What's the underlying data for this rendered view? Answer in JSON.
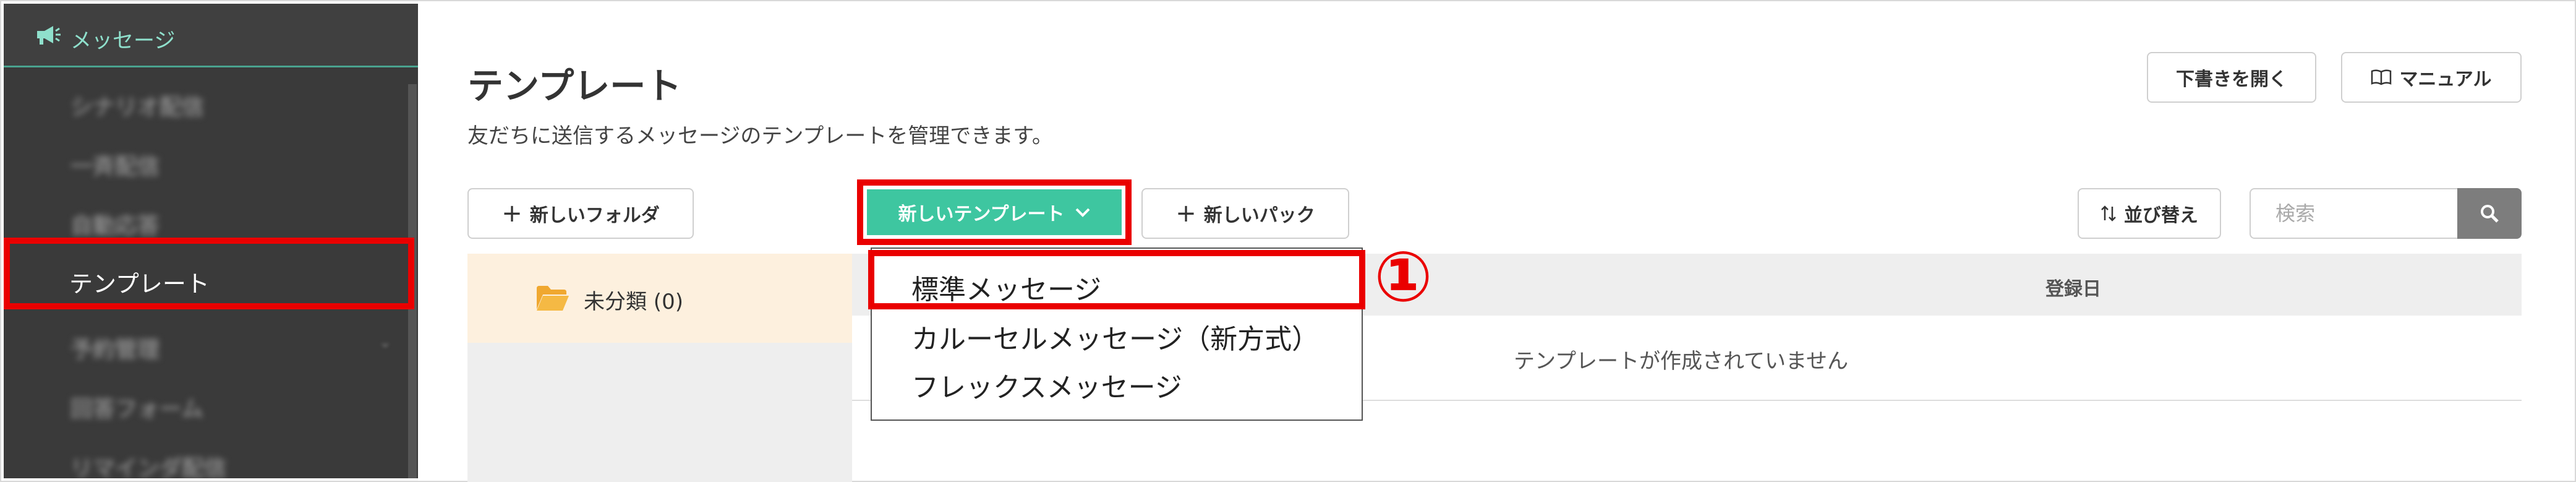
{
  "sidebar": {
    "section_label": "メッセージ",
    "blurred_items": [
      "シナリオ配信",
      "一斉配信",
      "自動応答",
      "予約管理",
      "回答フォーム",
      "リマインダ配信"
    ],
    "active_item": "テンプレート"
  },
  "page": {
    "title": "テンプレート",
    "subtitle": "友だちに送信するメッセージのテンプレートを管理できます。"
  },
  "header_buttons": {
    "open_draft": "下書きを開く",
    "manual": "マニュアル"
  },
  "toolbar": {
    "new_folder": "新しいフォルダ",
    "new_template": "新しいテンプレート",
    "new_pack": "新しいパック",
    "sort": "並び替え",
    "search_placeholder": "検索"
  },
  "folders": [
    {
      "label": "未分類 (0)"
    }
  ],
  "table": {
    "column_registered": "登録日",
    "empty_message": "テンプレートが作成されていません"
  },
  "dropdown": {
    "items": [
      "標準メッセージ",
      "カルーセルメッセージ（新方式）",
      "フレックスメッセージ"
    ]
  },
  "annotation_marker": "①",
  "colors": {
    "accent": "#3ec6a0",
    "highlight": "#ea0000",
    "sidebar_bg": "#3a3a3a",
    "folder_selected_bg": "#fdf0de",
    "folder_icon": "#f0a830"
  },
  "icons": {
    "section": "megaphone-icon",
    "manual": "book-icon",
    "sort": "sort-arrows-icon",
    "search": "search-icon",
    "folder": "folder-open-icon",
    "dropdown": "chevron-down-icon"
  }
}
